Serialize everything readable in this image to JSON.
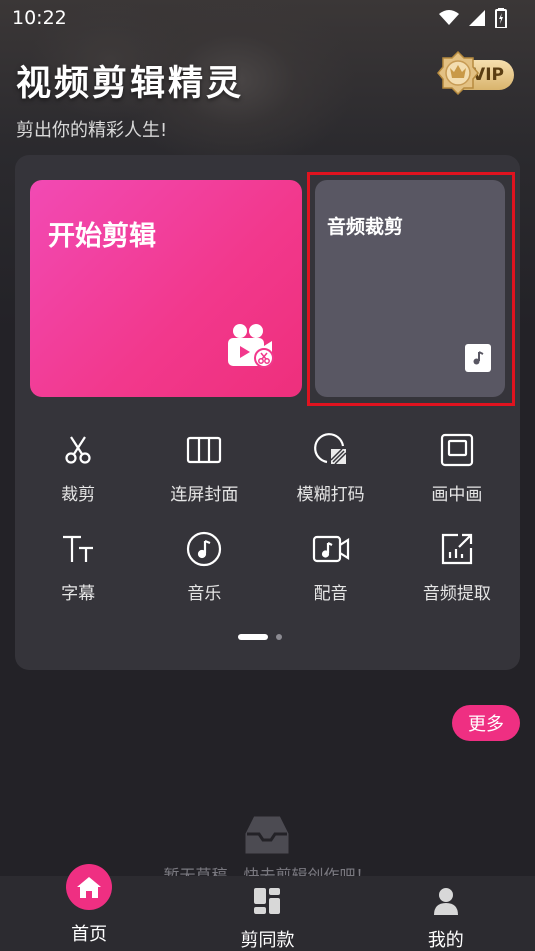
{
  "status_bar": {
    "time": "10:22",
    "icons": [
      "wifi-icon",
      "signal-icon",
      "battery-icon"
    ]
  },
  "header": {
    "title": "视频剪辑精灵",
    "subtitle": "剪出你的精彩人生!",
    "vip_label": "VIP",
    "medal_text": "VIP"
  },
  "cards": {
    "start_edit": {
      "label": "开始剪辑",
      "icon": "video-camera-scissors-icon"
    },
    "audio_cut": {
      "label": "音频裁剪",
      "icon": "music-file-icon"
    }
  },
  "tools": [
    {
      "label": "裁剪",
      "icon": "scissors-icon"
    },
    {
      "label": "连屏封面",
      "icon": "columns-icon"
    },
    {
      "label": "模糊打码",
      "icon": "blur-circle-icon"
    },
    {
      "label": "画中画",
      "icon": "picture-in-picture-icon"
    },
    {
      "label": "字幕",
      "icon": "text-icon"
    },
    {
      "label": "音乐",
      "icon": "music-note-icon"
    },
    {
      "label": "配音",
      "icon": "video-music-icon"
    },
    {
      "label": "音频提取",
      "icon": "export-chart-icon"
    }
  ],
  "pager": {
    "pages": 2,
    "active": 1
  },
  "more_button": "更多",
  "empty_state": {
    "text": "暂无草稿，快去剪辑创作吧！",
    "icon": "inbox-icon"
  },
  "bottom_nav": [
    {
      "label": "首页",
      "icon": "home-icon",
      "active": true
    },
    {
      "label": "剪同款",
      "icon": "template-icon",
      "active": false
    },
    {
      "label": "我的",
      "icon": "user-icon",
      "active": false
    }
  ],
  "colors": {
    "accent": "#ef2f82",
    "card_gradient_start": "#f24ab4",
    "card_gradient_end": "#ee2f7c",
    "highlight_border": "#e0131f",
    "panel": "#35343a",
    "background": "#232227"
  }
}
